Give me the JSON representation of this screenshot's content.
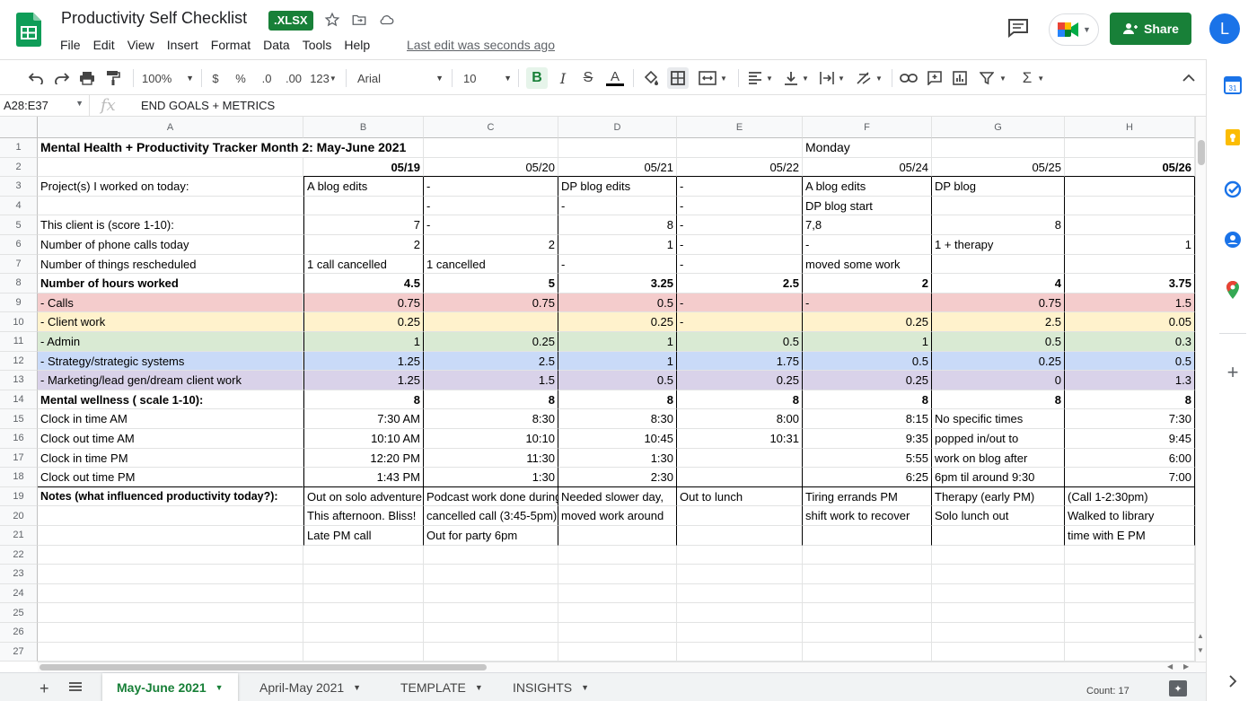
{
  "app": {
    "title": "Productivity Self Checklist",
    "badge": ".XLSX",
    "menu": [
      "File",
      "Edit",
      "View",
      "Insert",
      "Format",
      "Data",
      "Tools",
      "Help"
    ],
    "last_edit": "Last edit was seconds ago",
    "share_label": "Share",
    "avatar_letter": "L",
    "brand_color": "#188038"
  },
  "toolbar": {
    "zoom": "100%",
    "currency": "$",
    "percent": "%",
    "dec_decrease": ".0",
    "dec_increase": ".00",
    "format_more": "123",
    "font": "Arial",
    "font_size": "10"
  },
  "formula_bar": {
    "name_box": "A28:E37",
    "fx": "fx",
    "value": "END GOALS + METRICS"
  },
  "columns": [
    "A",
    "B",
    "C",
    "D",
    "E",
    "F",
    "G",
    "H"
  ],
  "row_numbers": [
    "1",
    "2",
    "3",
    "4",
    "5",
    "6",
    "7",
    "8",
    "9",
    "10",
    "11",
    "12",
    "13",
    "14",
    "15",
    "16",
    "17",
    "18",
    "19",
    "20",
    "21",
    "22",
    "23",
    "24",
    "25",
    "26",
    "27"
  ],
  "rows": [
    [
      "Mental Health + Productivity Tracker Month 2: May-June 2021",
      "",
      "",
      "",
      "",
      "Monday",
      "",
      ""
    ],
    [
      "",
      "05/19",
      "05/20",
      "05/21",
      "05/22",
      "05/24",
      "05/25",
      "05/26"
    ],
    [
      "Project(s) I worked on today:",
      "A blog edits",
      "-",
      "DP blog edits",
      "-",
      "A blog edits",
      "DP blog",
      ""
    ],
    [
      "",
      "",
      "-",
      "-",
      "-",
      "DP blog start",
      "",
      ""
    ],
    [
      "This client is (score 1-10):",
      "7",
      "-",
      "8",
      "-",
      "7,8",
      "8",
      ""
    ],
    [
      "Number of phone calls today",
      "2",
      "2",
      "1",
      "-",
      "-",
      "1 + therapy",
      "1"
    ],
    [
      "Number of things rescheduled",
      "1 call cancelled",
      "1 cancelled",
      "-",
      "-",
      "moved some work",
      "",
      ""
    ],
    [
      "Number of hours worked",
      "4.5",
      "5",
      "3.25",
      "2.5",
      "2",
      "4",
      "3.75"
    ],
    [
      "- Calls",
      "0.75",
      "0.75",
      "0.5",
      "-",
      "-",
      "0.75",
      "1.5"
    ],
    [
      "- Client work",
      "0.25",
      "",
      "0.25",
      "-",
      "0.25",
      "2.5",
      "0.05"
    ],
    [
      "- Admin",
      "1",
      "0.25",
      "1",
      "0.5",
      "1",
      "0.5",
      "0.3"
    ],
    [
      "- Strategy/strategic systems",
      "1.25",
      "2.5",
      "1",
      "1.75",
      "0.5",
      "0.25",
      "0.5"
    ],
    [
      "- Marketing/lead gen/dream client work",
      "1.25",
      "1.5",
      "0.5",
      "0.25",
      "0.25",
      "0",
      "1.3"
    ],
    [
      "Mental wellness ( scale 1-10):",
      "8",
      "8",
      "8",
      "8",
      "8",
      "8",
      "8"
    ],
    [
      "Clock in time AM",
      "7:30 AM",
      "8:30",
      "8:30",
      "8:00",
      "8:15",
      "No specific times",
      "7:30"
    ],
    [
      "Clock out time AM",
      "10:10 AM",
      "10:10",
      "10:45",
      "10:31",
      "9:35",
      "popped in/out to",
      "9:45"
    ],
    [
      "Clock in time PM",
      "12:20 PM",
      "11:30",
      "1:30",
      "",
      "5:55",
      "work on blog after",
      "6:00"
    ],
    [
      "Clock out time PM",
      "1:43 PM",
      "1:30",
      "2:30",
      "",
      "6:25",
      "6pm til around 9:30",
      "7:00"
    ],
    [
      "Notes (what influenced productivity today?):",
      "Out on solo adventure",
      "Podcast work done during",
      "Needed slower day,",
      "Out to lunch",
      "Tiring errands PM",
      "Therapy (early PM)",
      "(Call 1-2:30pm)"
    ],
    [
      "",
      "This afternoon. Bliss!",
      "cancelled call (3:45-5pm)",
      "moved work around",
      "",
      "shift work to recover",
      "Solo lunch out",
      "Walked to library"
    ],
    [
      "",
      "Late PM call",
      "Out for party 6pm",
      "",
      "",
      "",
      "",
      "time with E PM"
    ],
    [
      "",
      "",
      "",
      "",
      "",
      "",
      "",
      ""
    ],
    [
      "",
      "",
      "",
      "",
      "",
      "",
      "",
      ""
    ],
    [
      "",
      "",
      "",
      "",
      "",
      "",
      "",
      ""
    ],
    [
      "",
      "",
      "",
      "",
      "",
      "",
      "",
      ""
    ],
    [
      "",
      "",
      "",
      "",
      "",
      "",
      "",
      ""
    ],
    [
      "",
      "",
      "",
      "",
      "",
      "",
      "",
      ""
    ]
  ],
  "row_colors": {
    "calls": "#f4cccc",
    "client_work": "#fff2cc",
    "admin": "#d9ead3",
    "strategy": "#c9daf8",
    "marketing": "#d9d2e9"
  },
  "sheets": [
    {
      "label": "May-June 2021",
      "active": true
    },
    {
      "label": "April-May 2021",
      "active": false
    },
    {
      "label": "TEMPLATE",
      "active": false
    },
    {
      "label": "INSIGHTS",
      "active": false
    }
  ],
  "status": {
    "count": "Count: 17"
  }
}
